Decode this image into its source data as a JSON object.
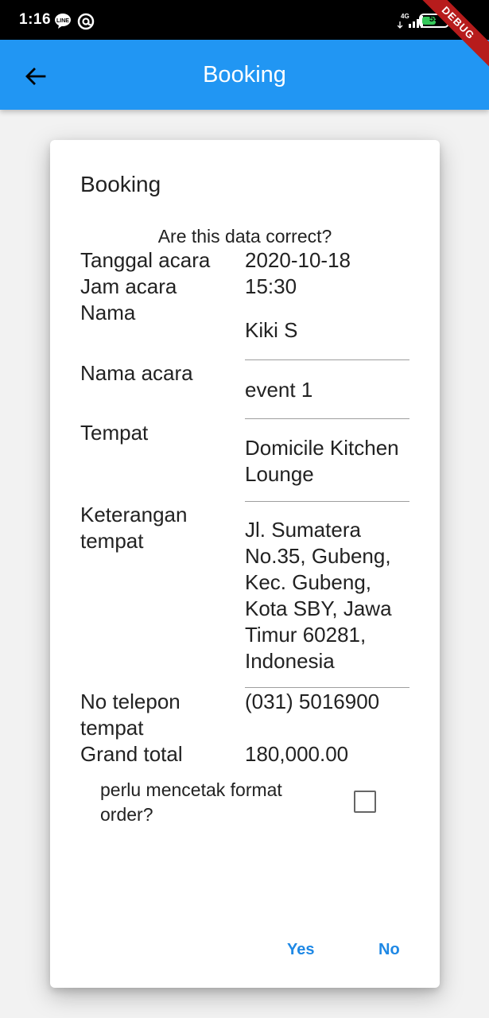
{
  "status_bar": {
    "time": "1:16",
    "battery_level": "55",
    "network": "4G",
    "icons": [
      "line-icon",
      "at-icon",
      "signal-icon",
      "battery-icon"
    ]
  },
  "debug_banner": "DEBUG",
  "app_bar": {
    "title": "Booking",
    "back_icon": "arrow-back-icon",
    "color": "#2196f3"
  },
  "dialog": {
    "title": "Booking",
    "question": "Are this data correct?",
    "rows": [
      {
        "label": "Tanggal acara",
        "value": "2020-10-18"
      },
      {
        "label": "Jam acara",
        "value": "15:30"
      },
      {
        "label": "Nama",
        "value": "Kiki S"
      },
      {
        "label": "Nama acara",
        "value": "event 1"
      },
      {
        "label": "Tempat",
        "value": "Domicile Kitchen Lounge"
      },
      {
        "label": "Keterangan tempat",
        "value": "Jl. Sumatera No.35, Gubeng, Kec. Gubeng, Kota SBY, Jawa Timur 60281, Indonesia"
      },
      {
        "label": "No telepon tempat",
        "value": "(031) 5016900"
      },
      {
        "label": "Grand total",
        "value": "180,000.00"
      }
    ],
    "checkbox": {
      "label": "perlu mencetak format order?",
      "checked": false
    },
    "actions": {
      "yes": "Yes",
      "no": "No"
    },
    "accent_color": "#1e88e5"
  }
}
